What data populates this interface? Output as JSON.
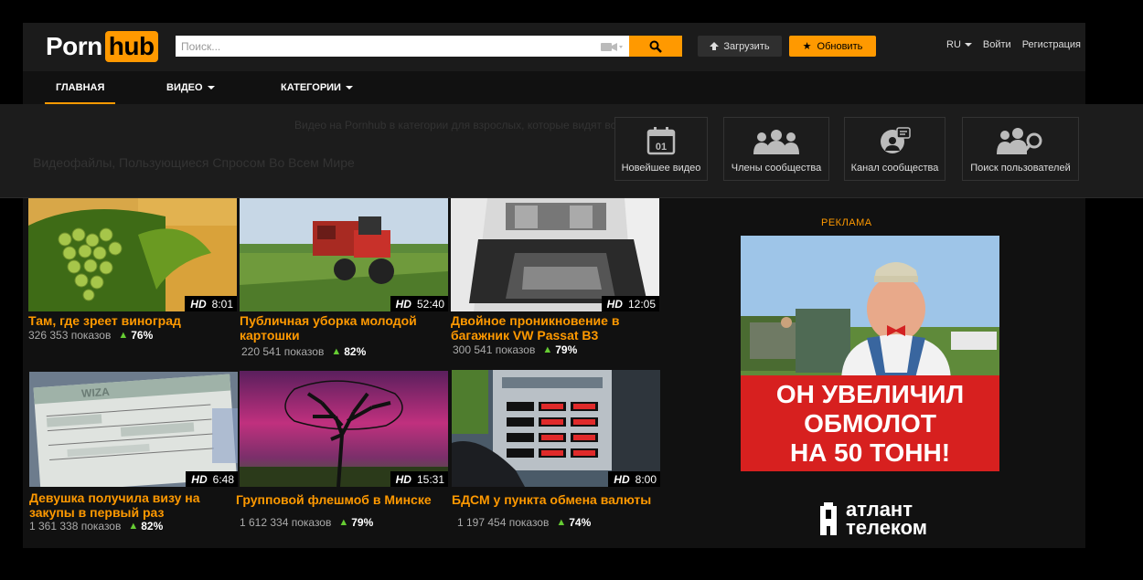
{
  "header": {
    "logo_word": "Porn",
    "logo_box": "hub",
    "search_placeholder": "Поиск...",
    "upload_label": "Загрузить",
    "upgrade_label": "Обновить",
    "lang": "RU",
    "login": "Войти",
    "register": "Регистрация"
  },
  "nav": {
    "home": "ГЛАВНАЯ",
    "video": "ВИДЕО",
    "categories": "КАТЕГОРИИ"
  },
  "dropdown": {
    "calendar_day": "01",
    "newest": "Новейшее видео",
    "members": "Члены сообщества",
    "channel": "Канал сообщества",
    "search_users": "Поиск пользователей",
    "faded_line": "Видео на Pornhub в категории для взрослых, которые видят все просмотры...",
    "faded_heading": "Видеофайлы, Пользующиеся Спросом Во Всем Мире"
  },
  "videos": [
    {
      "duration": "8:01",
      "title": "Там, где зреет виноград",
      "views": "326 353 показов",
      "rating": "76%"
    },
    {
      "duration": "52:40",
      "title": "Публичная уборка молодой картошки",
      "views": "220 541 показов",
      "rating": "82%"
    },
    {
      "duration": "12:05",
      "title": "Двойное проникновение в багажник VW Passat B3",
      "views": "300 541 показов",
      "rating": "79%"
    },
    {
      "duration": "6:48",
      "title": "Девушка получила визу на закупы в первый раз",
      "views": "1 361 338 показов",
      "rating": "82%"
    },
    {
      "duration": "15:31",
      "title": "Групповой флешмоб в Минске",
      "views": "1 612 334 показов",
      "rating": "79%"
    },
    {
      "duration": "8:00",
      "title": "БДСМ у пункта обмена валюты",
      "views": "1 197 454 показов",
      "rating": "74%"
    }
  ],
  "hd_label": "HD",
  "ad": {
    "label": "РЕКЛАМА",
    "line1": "ОН УВЕЛИЧИЛ",
    "line2": "ОБМОЛОТ",
    "line3": "НА 50 ТОНН!",
    "brand1": "атлант",
    "brand2": "телеком"
  }
}
